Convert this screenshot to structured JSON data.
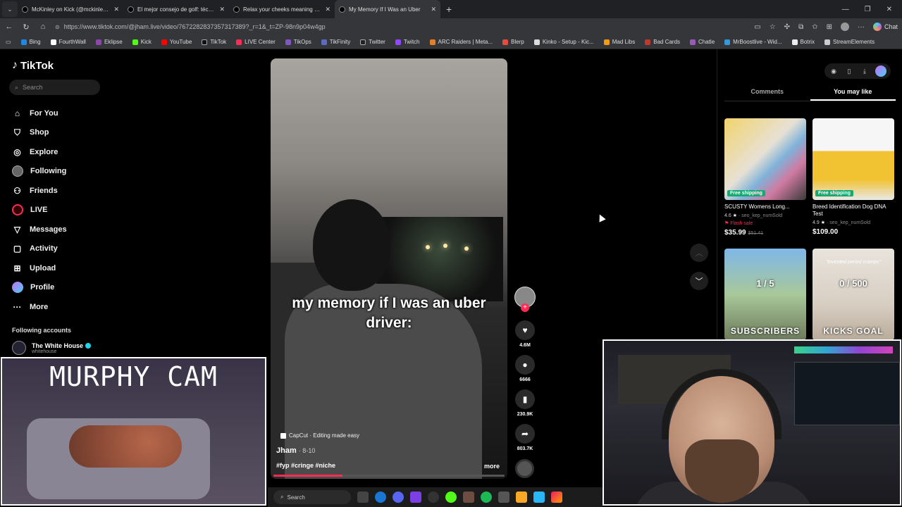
{
  "browser": {
    "tabs": [
      {
        "label": "McKinley on Kick (@mckinley.tv) |",
        "active": false
      },
      {
        "label": "El mejor consejo de golf: técnica y",
        "active": false
      },
      {
        "label": "Relax your cheeks meaning at the",
        "active": false
      },
      {
        "label": "My Memory If I Was an Uber",
        "active": true
      }
    ],
    "new_tab": "+",
    "url": "https://www.tiktok.com/@jham.live/video/7672282837357317389?_r=1&_t=ZP-98n9p04w4gp",
    "chat_label": "Chat",
    "bookmarks": [
      "Bing",
      "FourthWall",
      "Eklipse",
      "Kick",
      "YouTube",
      "TikTok",
      "LIVE Center",
      "TikOps",
      "TikFinity",
      "Twitter",
      "Twitch",
      "ARC Raiders | Meta...",
      "Blerp",
      "Kinko - Setup - Kic...",
      "Mad Libs",
      "Bad Cards",
      "Chatle",
      "MrBoostlive - Wid...",
      "Botrix",
      "StreamElements"
    ]
  },
  "tiktok": {
    "logo": "TikTok",
    "search_placeholder": "Search",
    "nav": [
      "For You",
      "Shop",
      "Explore",
      "Following",
      "Friends",
      "LIVE",
      "Messages",
      "Activity",
      "Upload",
      "Profile",
      "More"
    ],
    "following_title": "Following accounts",
    "following": [
      {
        "name": "The White House",
        "handle": "whitehouse"
      }
    ]
  },
  "video": {
    "overlay_text": "my memory if I was an uber driver:",
    "capcut": "CapCut · Editing made easy",
    "author": "Jham",
    "date": "· 8-10",
    "tags": "#fyp #cringe #niche",
    "more": "more",
    "progress": 0.3,
    "likes": "4.6M",
    "comments": "6666",
    "saves": "230.9K",
    "shares": "803.7K"
  },
  "right_panel": {
    "tabs": [
      "Comments",
      "You may like"
    ],
    "active_tab": "You may like",
    "products": [
      {
        "name": "SCUSTY Womens Long...",
        "rating": "4.6",
        "sold": "seo_kep_numSold",
        "flash": "Flash sale",
        "price": "$35.99",
        "old_price": "$51.41",
        "badge": "Free shipping"
      },
      {
        "name": "Breed Identification Dog DNA Test",
        "rating": "4.9",
        "sold": "seo_kep_numSold",
        "price": "$109.00",
        "badge": "Free shipping"
      }
    ],
    "videos": [
      {
        "big": "1 / 5",
        "bottom": "SUBSCRIBERS"
      },
      {
        "top": "\"invented period cramps\"",
        "big": "0 / 500",
        "bottom": "KICKS GOAL"
      }
    ]
  },
  "overlays": {
    "murphy_title": "MURPHY CAM"
  },
  "taskbar": {
    "search": "Search"
  }
}
